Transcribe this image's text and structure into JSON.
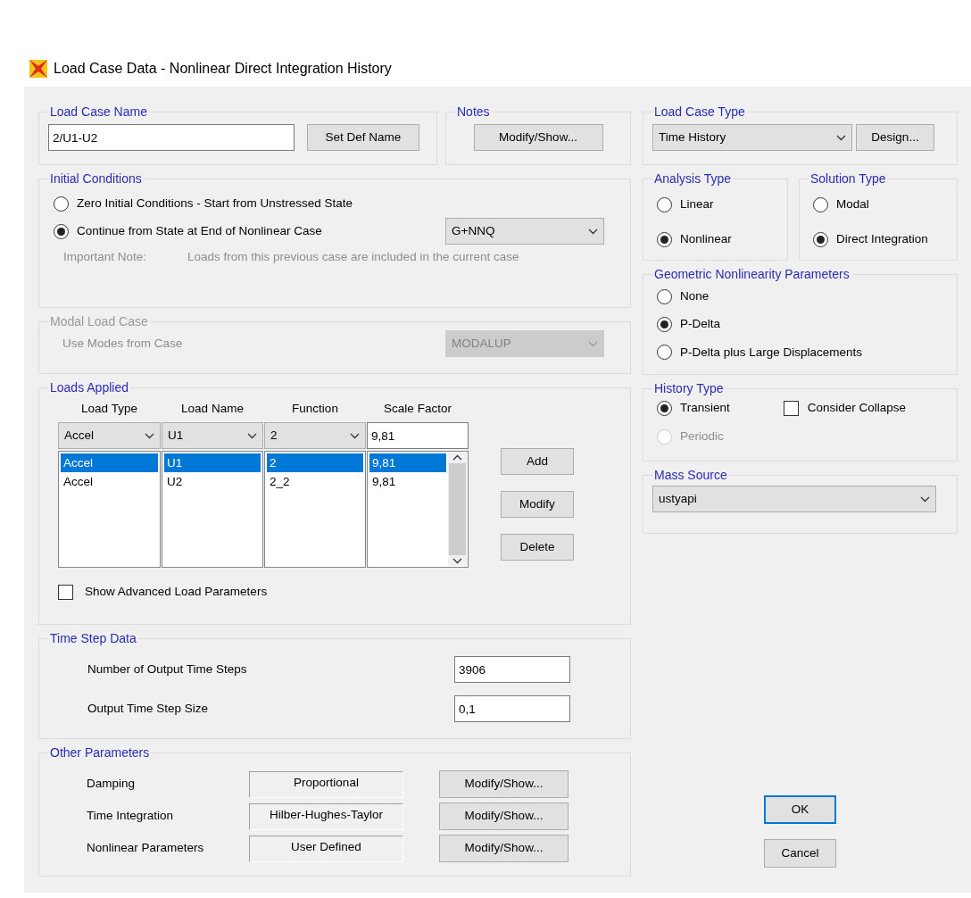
{
  "window": {
    "title": "Load Case Data - Nonlinear Direct Integration History"
  },
  "load_case_name": {
    "legend": "Load Case Name",
    "value": "2/U1-U2",
    "button": "Set Def Name"
  },
  "notes": {
    "legend": "Notes",
    "button": "Modify/Show..."
  },
  "initial_conditions": {
    "legend": "Initial Conditions",
    "options": [
      {
        "label": "Zero Initial Conditions - Start from Unstressed State",
        "selected": false
      },
      {
        "label": "Continue from State at End of Nonlinear Case",
        "selected": true
      }
    ],
    "case_select": "G+NNQ",
    "note_label": "Important Note:",
    "note_text": "Loads from this previous case are included in the current case"
  },
  "modal_load_case": {
    "legend": "Modal Load Case",
    "disabled": true,
    "label": "Use Modes from Case",
    "select": "MODALUP"
  },
  "loads_applied": {
    "legend": "Loads Applied",
    "columns": [
      "Load Type",
      "Load Name",
      "Function",
      "Scale Factor"
    ],
    "inputs": [
      "Accel",
      "U1",
      "2",
      "9,81"
    ],
    "rows": [
      {
        "cells": [
          "Accel",
          "U1",
          "2",
          "9,81"
        ],
        "selected": true
      },
      {
        "cells": [
          "Accel",
          "U2",
          "2_2",
          "9,81"
        ],
        "selected": false
      }
    ],
    "buttons": [
      "Add",
      "Modify",
      "Delete"
    ],
    "advanced": {
      "label": "Show Advanced Load Parameters",
      "checked": false
    }
  },
  "time_step_data": {
    "legend": "Time Step Data",
    "fields": [
      {
        "label": "Number of Output Time Steps",
        "value": "3906"
      },
      {
        "label": "Output Time Step Size",
        "value": "0,1"
      }
    ]
  },
  "other_parameters": {
    "legend": "Other Parameters",
    "rows": [
      {
        "label": "Damping",
        "value": "Proportional",
        "button": "Modify/Show..."
      },
      {
        "label": "Time Integration",
        "value": "Hilber-Hughes-Taylor",
        "button": "Modify/Show..."
      },
      {
        "label": "Nonlinear Parameters",
        "value": "User Defined",
        "button": "Modify/Show..."
      }
    ]
  },
  "load_case_type": {
    "legend": "Load Case Type",
    "select": "Time History",
    "button": "Design..."
  },
  "analysis_type": {
    "legend": "Analysis Type",
    "options": [
      {
        "label": "Linear",
        "selected": false
      },
      {
        "label": "Nonlinear",
        "selected": true
      }
    ]
  },
  "solution_type": {
    "legend": "Solution Type",
    "options": [
      {
        "label": "Modal",
        "selected": false
      },
      {
        "label": "Direct Integration",
        "selected": true
      }
    ]
  },
  "geometric_nonlinearity": {
    "legend": "Geometric Nonlinearity Parameters",
    "options": [
      {
        "label": "None",
        "selected": false
      },
      {
        "label": "P-Delta",
        "selected": true
      },
      {
        "label": "P-Delta plus Large Displacements",
        "selected": false
      }
    ]
  },
  "history_type": {
    "legend": "History Type",
    "options": [
      {
        "label": "Transient",
        "selected": true,
        "disabled": false
      },
      {
        "label": "Periodic",
        "selected": false,
        "disabled": true
      }
    ],
    "consider_collapse": {
      "label": "Consider Collapse",
      "checked": false
    }
  },
  "mass_source": {
    "legend": "Mass Source",
    "select": "ustyapi"
  },
  "buttons": [
    {
      "label": "OK",
      "default": true
    },
    {
      "label": "Cancel",
      "default": false
    }
  ]
}
